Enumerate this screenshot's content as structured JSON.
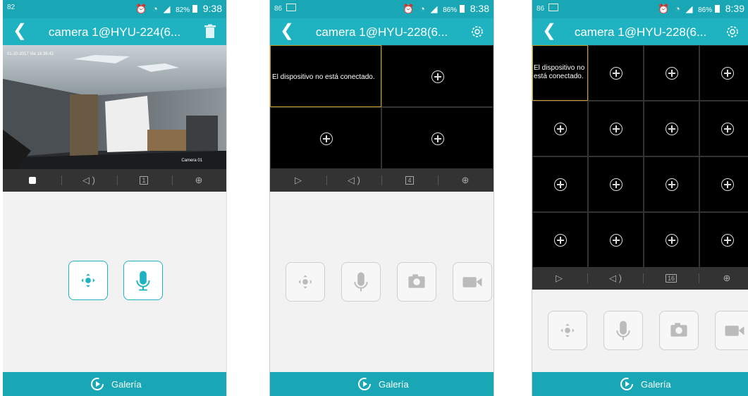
{
  "phones": [
    {
      "status": {
        "left_icon": "82",
        "right_text": "82%",
        "time": "9:38"
      },
      "title": "camera 1@HYU-224(6...",
      "action_icon": "trash-icon",
      "camera_osd": "01-20-2017 Vie 16:36:42",
      "camera_label": "Camera 01",
      "controls": {
        "stop": "stop-icon",
        "audio": "speaker-icon",
        "layout": "1",
        "zoom": "zoom-in-icon"
      },
      "tools": [
        "ptz-icon",
        "microphone-icon"
      ],
      "gallery": "Galería"
    },
    {
      "status": {
        "left_icon": "86",
        "right_text": "86%",
        "time": "8:38"
      },
      "title": "camera 1@HYU-228(6...",
      "action_icon": "gear-icon",
      "grid_message": "El dispositivo no está conectado.",
      "controls": {
        "play": "play-icon",
        "audio": "speaker-icon",
        "layout": "4",
        "zoom": "zoom-in-icon"
      },
      "tools": [
        "ptz-icon",
        "microphone-icon",
        "snapshot-icon",
        "record-icon"
      ],
      "gallery": "Galería"
    },
    {
      "status": {
        "left_icon": "86",
        "right_text": "86%",
        "time": "8:39"
      },
      "title": "camera 1@HYU-228(6...",
      "action_icon": "gear-icon",
      "grid_message_line1": "El dispositivo no",
      "grid_message_line2": "está conectado.",
      "controls": {
        "play": "play-icon",
        "audio": "speaker-icon",
        "layout": "16",
        "zoom": "zoom-in-icon"
      },
      "tools": [
        "ptz-icon",
        "microphone-icon",
        "snapshot-icon",
        "record-icon"
      ],
      "gallery": "Galería"
    }
  ],
  "colors": {
    "header": "#1fb3c1",
    "status": "#19a7b5",
    "control_bar": "#333333",
    "selected_cell": "#c99b2a"
  }
}
